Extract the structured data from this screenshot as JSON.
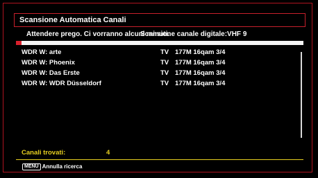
{
  "dialog": {
    "title": "Scansione Automatica Canali",
    "wait_message": "Attendere prego. Ci vorranno alcuni minuti.",
    "scan_status": "Scansione canale digitale:VHF 9",
    "progress_fraction": 0.02
  },
  "channels": [
    {
      "name": "WDR W: arte",
      "type": "TV",
      "freq": "177M 16qam 3/4"
    },
    {
      "name": "WDR W: Phoenix",
      "type": "TV",
      "freq": "177M 16qam 3/4"
    },
    {
      "name": "WDR W: Das Erste",
      "type": "TV",
      "freq": "177M 16qam 3/4"
    },
    {
      "name": "WDR W: WDR Düsseldorf",
      "type": "TV",
      "freq": "177M 16qam 3/4"
    }
  ],
  "found": {
    "label": "Canali trovati:",
    "count": "4"
  },
  "footer": {
    "key": "MENU",
    "action": "Annulla ricerca"
  },
  "colors": {
    "accent": "#d8202c",
    "highlight": "#e8d020",
    "background": "#000000"
  }
}
